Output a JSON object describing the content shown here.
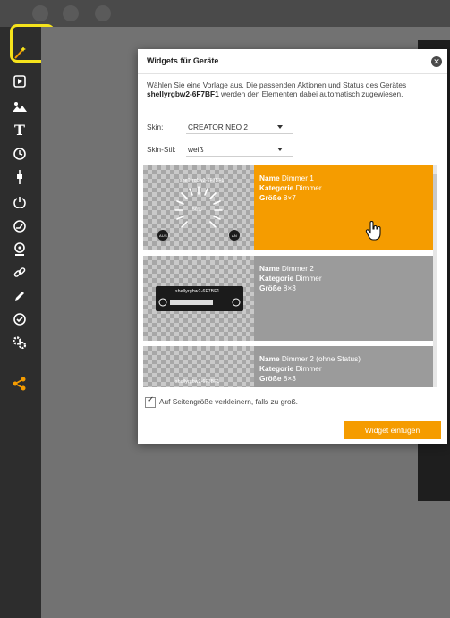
{
  "dialog": {
    "title": "Widgets für Geräte",
    "close_symbol": "✕",
    "desc_before": "Wählen Sie eine Vorlage aus. Die passenden Aktionen und Status des Gerätes ",
    "device": "shellyrgbw2-6F7BF1",
    "desc_after": " werden den Elementen dabei automatisch zugewiesen.",
    "skin_label": "Skin:",
    "skin_value": "CREATOR NEO 2",
    "skin_style_label": "Skin-Stil:",
    "skin_style_value": "weiß",
    "shrink_checkbox": {
      "label": "Auf Seitengröße verkleinern, falls zu groß.",
      "checked": true
    },
    "insert_button": "Widget einfügen"
  },
  "labels": {
    "name": "Name",
    "category": "Kategorie",
    "size": "Größe"
  },
  "widgets": [
    {
      "name": "Dimmer 1",
      "category": "Dimmer",
      "size": "8×7",
      "selected": true,
      "preview_title": "shellyrgbw2-6F7BF1",
      "preview_value": "50%",
      "preview_off": "AUS",
      "preview_on": "AN"
    },
    {
      "name": "Dimmer 2",
      "category": "Dimmer",
      "size": "8×3",
      "selected": false,
      "preview_title": "shellyrgbw2-6F7BF1"
    },
    {
      "name": "Dimmer 2 (ohne Status)",
      "category": "Dimmer",
      "size": "8×3",
      "selected": false,
      "preview_title": "shellyrgbw2-6F7BF1"
    }
  ],
  "sidebar_icons": [
    "wand-icon",
    "play-icon",
    "image-icon",
    "text-icon",
    "clock-icon",
    "plug-icon",
    "power-icon",
    "gauge-icon",
    "webcam-icon",
    "link-icon",
    "pen-icon",
    "check-icon",
    "gears-icon",
    "share-icon"
  ],
  "colors": {
    "accent": "#f59c00",
    "highlight": "#f5e31c",
    "sidebar": "#2d2d2d"
  }
}
